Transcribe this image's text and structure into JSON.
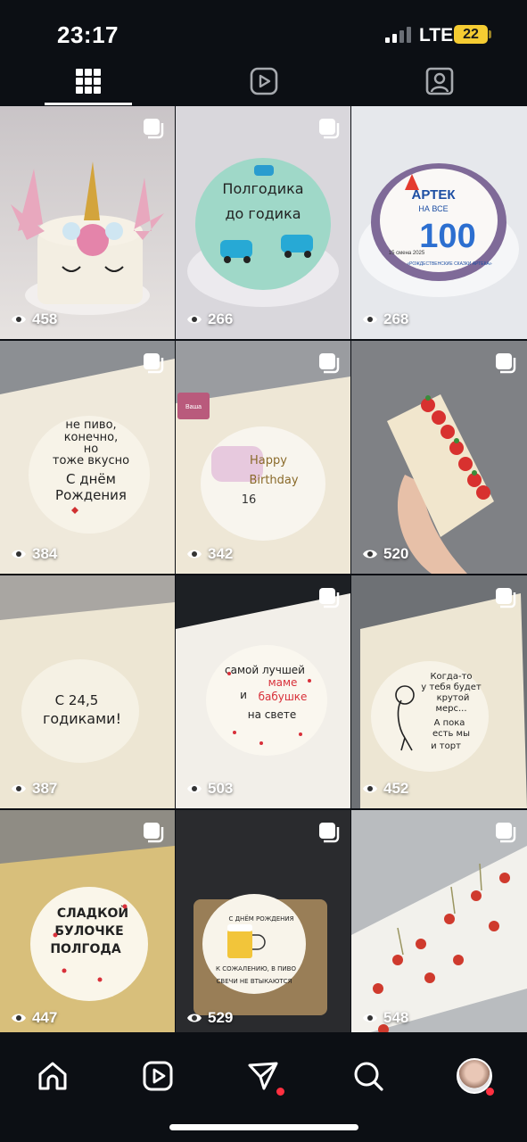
{
  "status_bar": {
    "time": "23:17",
    "network": "LTE",
    "battery": "22"
  },
  "profile_tabs": [
    {
      "name": "grid",
      "icon": "grid-icon",
      "active": true
    },
    {
      "name": "reels",
      "icon": "reels-icon",
      "active": false
    },
    {
      "name": "tagged",
      "icon": "tagged-person-icon",
      "active": false
    }
  ],
  "posts": [
    {
      "views": "458",
      "multi": true
    },
    {
      "views": "266",
      "multi": true,
      "text": [
        "Полгодика",
        "до годика"
      ]
    },
    {
      "views": "268",
      "multi": false,
      "text": [
        "АРТЕК",
        "НА ВСЕ",
        "100",
        "15 смена 2025",
        "«РОЖДЕСТВЕНСКИЕ СКАЗКИ АРТЕКА»"
      ]
    },
    {
      "views": "384",
      "multi": true,
      "text": [
        "не пиво,",
        "конечно,",
        "но",
        "тоже вкусно",
        "С днём",
        "Рождения"
      ]
    },
    {
      "views": "342",
      "multi": true,
      "text": [
        "Happy",
        "Birthday",
        "16",
        "Ваша"
      ]
    },
    {
      "views": "520",
      "multi": true
    },
    {
      "views": "387",
      "multi": false,
      "text": [
        "С 24,5",
        "годиками!"
      ]
    },
    {
      "views": "503",
      "multi": true,
      "text": [
        "самой лучшей",
        "маме",
        "и",
        "бабушке",
        "на свете"
      ]
    },
    {
      "views": "452",
      "multi": true,
      "text": [
        "Когда-то",
        "у тебя будет",
        "крутой",
        "мерс...",
        "А пока",
        "есть мы",
        "и торт"
      ]
    },
    {
      "views": "447",
      "multi": true,
      "text": [
        "СЛАДКОЙ",
        "БУЛОЧКЕ",
        "ПОЛГОДА"
      ]
    },
    {
      "views": "529",
      "multi": true,
      "text": [
        "С ДНЁМ РОЖДЕНИЯ",
        "К СОЖАЛЕНИЮ, В ПИВО",
        "СВЕЧИ НЕ ВТЫКАЮТСЯ"
      ]
    },
    {
      "views": "548",
      "multi": true
    }
  ],
  "bottom_nav": [
    {
      "name": "home",
      "icon": "home-icon"
    },
    {
      "name": "reels",
      "icon": "reels-icon"
    },
    {
      "name": "direct",
      "icon": "send-icon",
      "notification": true
    },
    {
      "name": "search",
      "icon": "search-icon"
    },
    {
      "name": "profile",
      "icon": "avatar",
      "notification": true
    }
  ],
  "colors": {
    "background": "#0c0f14",
    "accent_dot": "#ff3040",
    "battery": "#f5cc32"
  }
}
